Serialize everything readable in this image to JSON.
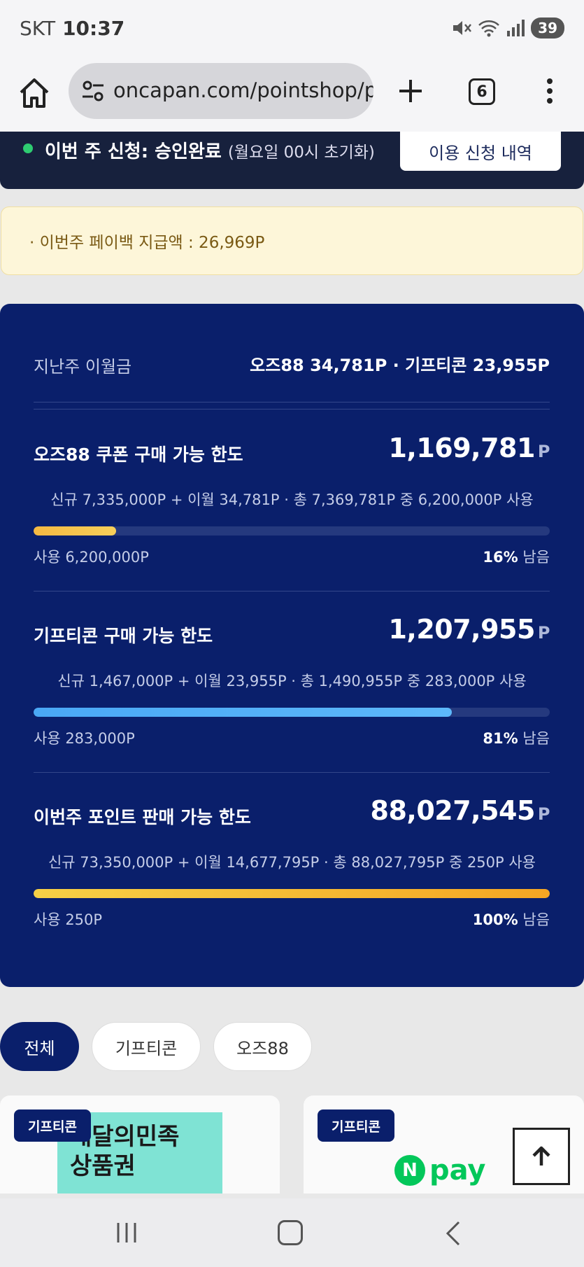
{
  "status_bar": {
    "carrier": "SKT",
    "time": "10:37",
    "battery": "39",
    "icons": [
      "mute-icon",
      "wifi-icon",
      "signal-icon",
      "battery-icon"
    ]
  },
  "browser": {
    "url": "oncapan.com/pointshop/pc",
    "tab_count": "6"
  },
  "header": {
    "apply_status_label": "이번 주 신청: 승인완료",
    "apply_status_sub": "(월요일 00시 초기화)",
    "history_button": "이용 신청 내역"
  },
  "payback": {
    "text": "· 이번주 페이백 지급액 : 26,969P"
  },
  "summary": {
    "last_week_label": "지난주 이월금",
    "last_week_values": "오즈88 34,781P · 기프티콘 23,955P",
    "sections": [
      {
        "title": "오즈88 쿠폰 구매 가능 한도",
        "amount": "1,169,781",
        "unit": "P",
        "detail": "신규 7,335,000P + 이월 34,781P · 총 7,369,781P 중 6,200,000P 사용",
        "used": "사용 6,200,000P",
        "remain_pct": "16%",
        "remain_label": "남음",
        "progress": 0.16,
        "color_from": "#f5b942",
        "color_to": "#f7cf5a"
      },
      {
        "title": "기프티콘 구매 가능 한도",
        "amount": "1,207,955",
        "unit": "P",
        "detail": "신규 1,467,000P + 이월 23,955P · 총 1,490,955P 중 283,000P 사용",
        "used": "사용 283,000P",
        "remain_pct": "81%",
        "remain_label": "남음",
        "progress": 0.81,
        "color_from": "#4aa8f5",
        "color_to": "#5db8fa"
      },
      {
        "title": "이번주 포인트 판매 가능 한도",
        "amount": "88,027,545",
        "unit": "P",
        "detail": "신규 73,350,000P + 이월 14,677,795P · 총 88,027,795P 중 250P 사용",
        "used": "사용 250P",
        "remain_pct": "100%",
        "remain_label": "남음",
        "progress": 1.0,
        "color_from": "#f7d046",
        "color_to": "#f5a623"
      }
    ]
  },
  "filters": {
    "chips": [
      "전체",
      "기프티콘",
      "오즈88"
    ],
    "active": "전체"
  },
  "cards": [
    {
      "badge": "기프티콘",
      "image_line1": "배달의민족",
      "image_line2": "상품권"
    },
    {
      "badge": "기프티콘",
      "logo_letter": "N",
      "logo_text": "pay"
    }
  ],
  "colors": {
    "panel": "#0a1f6b",
    "header": "#17213d",
    "payback_bg": "#fdf6d9",
    "payback_text": "#7a5a14",
    "npay_green": "#03c75a"
  }
}
